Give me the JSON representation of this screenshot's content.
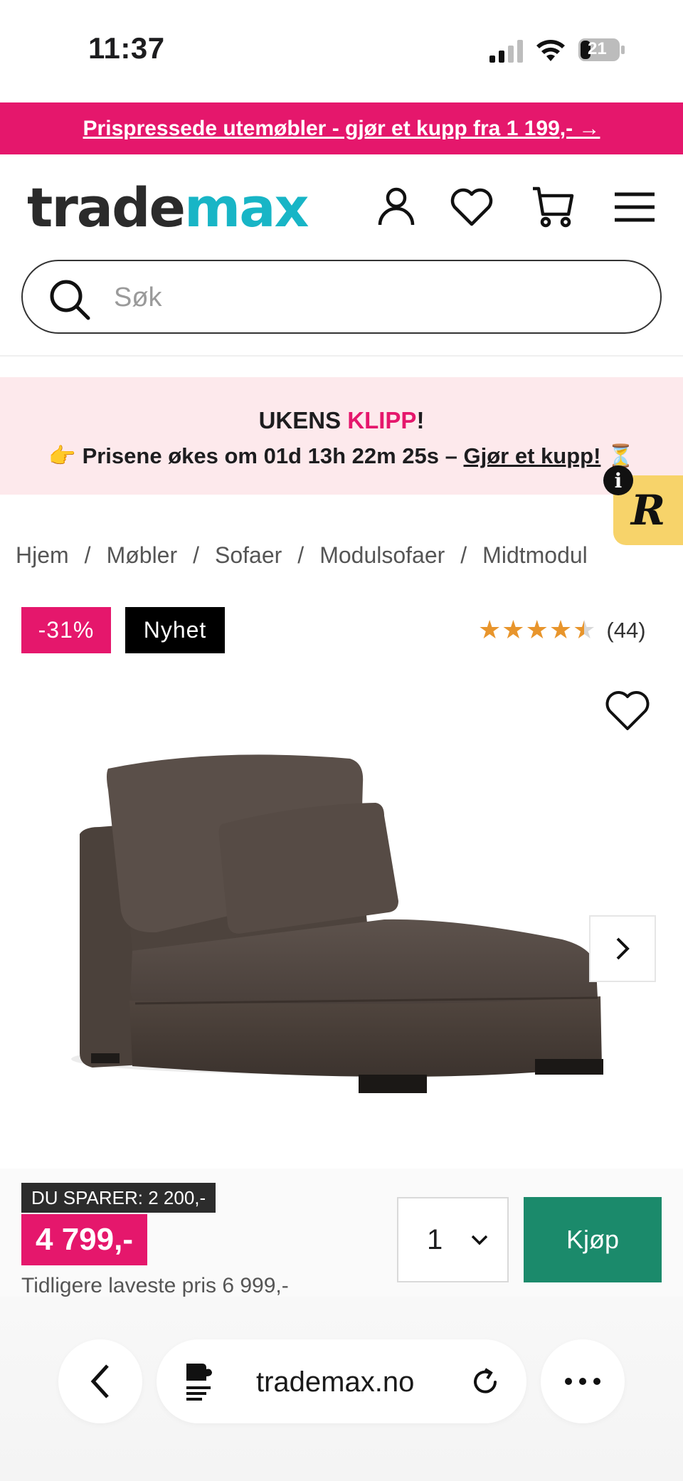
{
  "status_bar": {
    "time": "11:37",
    "battery": "21"
  },
  "promo": {
    "text": "Prispressede utemøbler - gjør et kupp fra 1 199,- →"
  },
  "header": {
    "logo_part1": "trade",
    "logo_part2": "max"
  },
  "search": {
    "placeholder": "Søk"
  },
  "deal_banner": {
    "title_prefix": "UKENS ",
    "title_highlight": "KLIPP",
    "title_suffix": "!",
    "countdown_text": "👉 Prisene økes om 01d 13h 22m 25s – ",
    "cta": "Gjør et kupp!",
    "hourglass": "⏳"
  },
  "reviews_badge": {
    "letter": "R",
    "info": "i"
  },
  "breadcrumb": [
    "Hjem",
    "Møbler",
    "Sofaer",
    "Modulsofaer",
    "Midtmodul"
  ],
  "breadcrumb_sep": "/",
  "badges": {
    "discount": "-31%",
    "new": "Nyhet"
  },
  "rating": {
    "stars": 4.5,
    "count": "(44)"
  },
  "buy": {
    "saving": "DU SPARER: 2 200,-",
    "price": "4 799,-",
    "previous": "Tidligere laveste pris 6 999,-",
    "quantity": "1",
    "button": "Kjøp"
  },
  "browser": {
    "url": "trademax.no"
  },
  "colors": {
    "brand_pink": "#e5176c",
    "brand_teal": "#18b5c6",
    "buy_green": "#1b8a6b"
  }
}
